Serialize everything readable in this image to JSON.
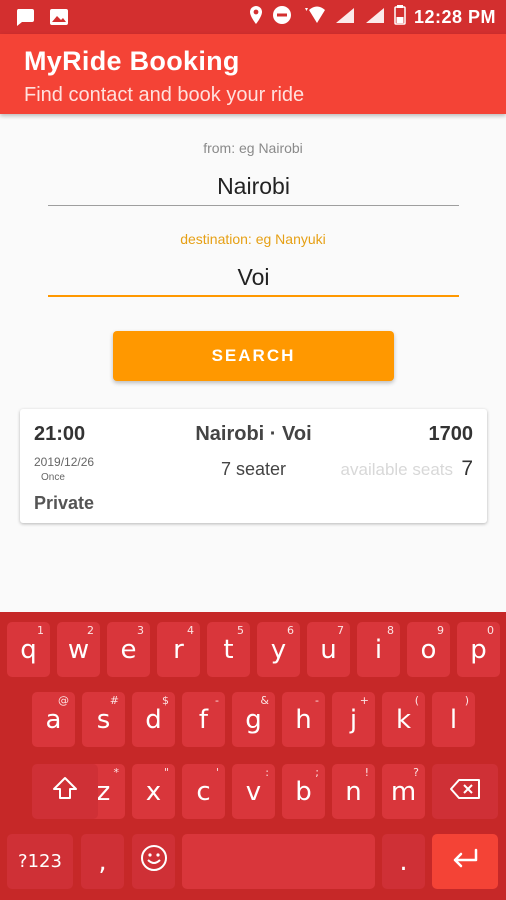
{
  "status_bar": {
    "time": "12:28 PM"
  },
  "app_bar": {
    "title": "MyRide Booking",
    "subtitle": "Find contact and book your ride"
  },
  "form": {
    "from_label": "from: eg Nairobi",
    "from_value": "Nairobi",
    "destination_label": "destination: eg Nanyuki",
    "destination_value": "Voi",
    "search_label": "SEARCH"
  },
  "result": {
    "time": "21:00",
    "route": "Nairobi · Voi",
    "price": "1700",
    "date": "2019/12/26",
    "frequency": "Once",
    "vehicle": "7 seater",
    "available_label": "available seats",
    "available_seats": "7",
    "type": "Private"
  },
  "keyboard": {
    "row1": [
      {
        "key": "q",
        "hint": "1"
      },
      {
        "key": "w",
        "hint": "2"
      },
      {
        "key": "e",
        "hint": "3"
      },
      {
        "key": "r",
        "hint": "4"
      },
      {
        "key": "t",
        "hint": "5"
      },
      {
        "key": "y",
        "hint": "6"
      },
      {
        "key": "u",
        "hint": "7"
      },
      {
        "key": "i",
        "hint": "8"
      },
      {
        "key": "o",
        "hint": "9"
      },
      {
        "key": "p",
        "hint": "0"
      }
    ],
    "row2": [
      {
        "key": "a",
        "hint": "@"
      },
      {
        "key": "s",
        "hint": "#"
      },
      {
        "key": "d",
        "hint": "$"
      },
      {
        "key": "f",
        "hint": "-"
      },
      {
        "key": "g",
        "hint": "&"
      },
      {
        "key": "h",
        "hint": "-"
      },
      {
        "key": "j",
        "hint": "+"
      },
      {
        "key": "k",
        "hint": "("
      },
      {
        "key": "l",
        "hint": ")"
      }
    ],
    "row3": [
      {
        "key": "z",
        "hint": "*"
      },
      {
        "key": "x",
        "hint": "\""
      },
      {
        "key": "c",
        "hint": "'"
      },
      {
        "key": "v",
        "hint": ":"
      },
      {
        "key": "b",
        "hint": ";"
      },
      {
        "key": "n",
        "hint": "!"
      },
      {
        "key": "m",
        "hint": "?"
      }
    ],
    "symbols_label": "?123",
    "comma": ",",
    "period": "."
  },
  "colors": {
    "status_bar": "#d32f2f",
    "app_bar": "#f44336",
    "accent": "#ff9800",
    "keyboard": "#c62828"
  }
}
